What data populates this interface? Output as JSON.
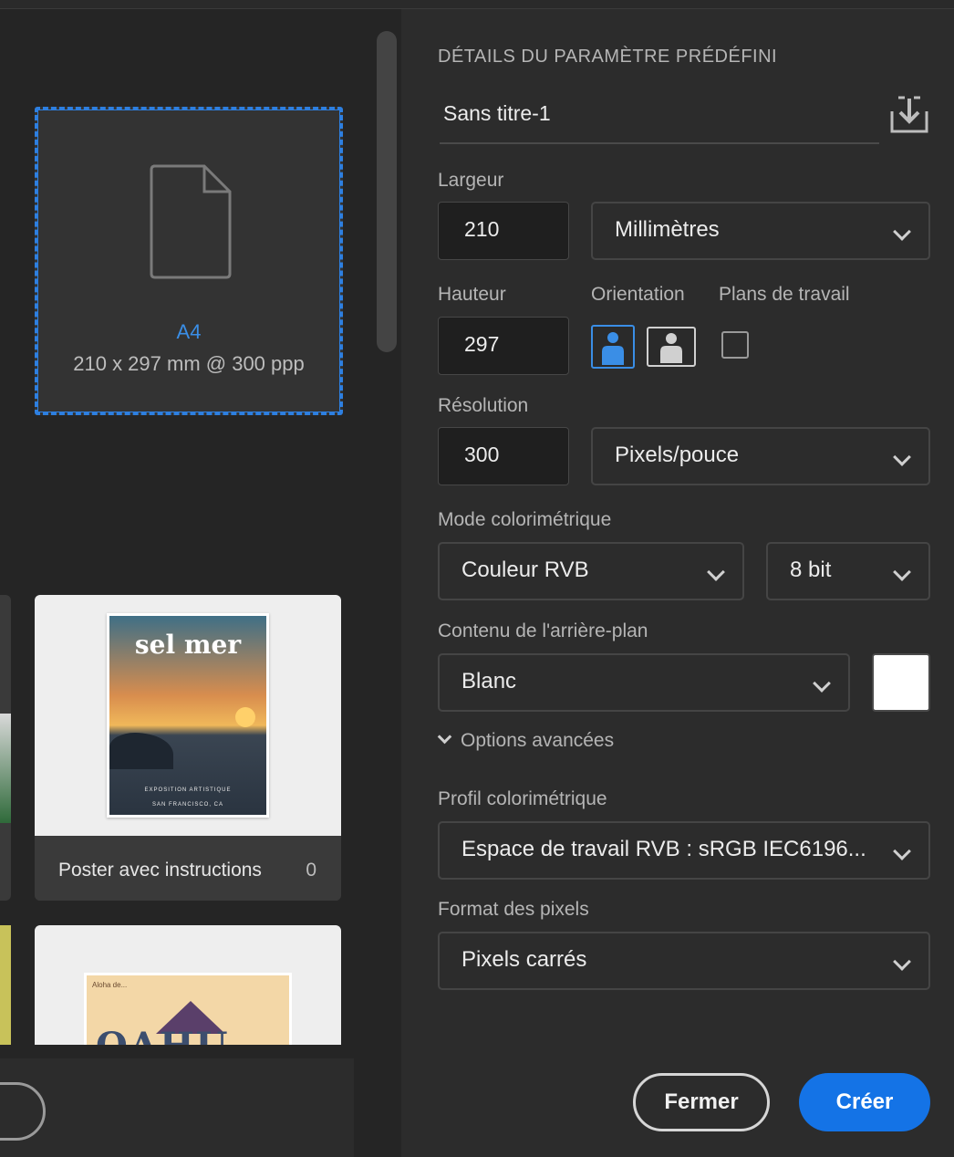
{
  "preset": {
    "name": "A4",
    "size": "210 x 297 mm @ 300 ppp"
  },
  "templates": [
    {
      "title": "Poster avec instructions",
      "count": "0",
      "thumb_text": "sel mer",
      "thumb_fine_1": "EXPOSITION ARTISTIQUE",
      "thumb_fine_2": "SAN FRANCISCO, CA"
    },
    {
      "thumb_text": "OAHU",
      "thumb_small": "Aloha de..."
    }
  ],
  "details": {
    "header": "DÉTAILS DU PARAMÈTRE PRÉDÉFINI",
    "doc_name": "Sans titre-1",
    "width_label": "Largeur",
    "width_value": "210",
    "width_unit": "Millimètres",
    "height_label": "Hauteur",
    "height_value": "297",
    "orientation_label": "Orientation",
    "artboards_label": "Plans de travail",
    "resolution_label": "Résolution",
    "resolution_value": "300",
    "resolution_unit": "Pixels/pouce",
    "color_mode_label": "Mode colorimétrique",
    "color_mode": "Couleur RVB",
    "bit_depth": "8 bit",
    "background_label": "Contenu de l'arrière-plan",
    "background": "Blanc",
    "advanced_label": "Options avancées",
    "color_profile_label": "Profil colorimétrique",
    "color_profile": "Espace de travail RVB : sRGB IEC6196...",
    "pixel_aspect_label": "Format des pixels",
    "pixel_aspect": "Pixels carrés"
  },
  "actions": {
    "close": "Fermer",
    "create": "Créer"
  },
  "colors": {
    "accent": "#1473e6",
    "selection": "#2d7fe0",
    "background_swatch": "#ffffff"
  }
}
